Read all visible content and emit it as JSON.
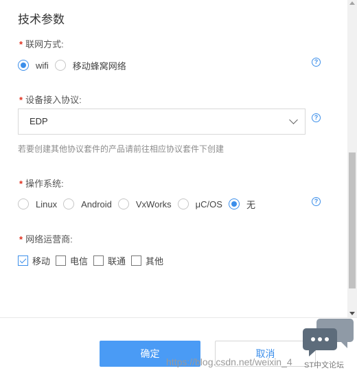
{
  "section_title": "技术参数",
  "network": {
    "label": "联网方式:",
    "options": [
      {
        "label": "wifi",
        "checked": true
      },
      {
        "label": "移动蜂窝网络",
        "checked": false
      }
    ]
  },
  "protocol": {
    "label": "设备接入协议:",
    "selected": "EDP",
    "hint": "若要创建其他协议套件的产品请前往相应协议套件下创建"
  },
  "os": {
    "label": "操作系统:",
    "options": [
      {
        "label": "Linux",
        "checked": false
      },
      {
        "label": "Android",
        "checked": false
      },
      {
        "label": "VxWorks",
        "checked": false
      },
      {
        "label": "μC/OS",
        "checked": false
      },
      {
        "label": "无",
        "checked": true
      }
    ]
  },
  "carrier": {
    "label": "网络运营商:",
    "options": [
      {
        "label": "移动",
        "checked": true
      },
      {
        "label": "电信",
        "checked": false
      },
      {
        "label": "联通",
        "checked": false
      },
      {
        "label": "其他",
        "checked": false
      }
    ]
  },
  "required_mark": "*",
  "help_glyph": "?",
  "buttons": {
    "confirm": "确定",
    "cancel": "取消"
  },
  "watermark": {
    "url": "https://blog.csdn.net/weixin_4",
    "caption": "ST中文论坛"
  },
  "colors": {
    "accent": "#3b8eea",
    "confirm_bg": "#4a9bf5",
    "required": "#e0301e"
  }
}
